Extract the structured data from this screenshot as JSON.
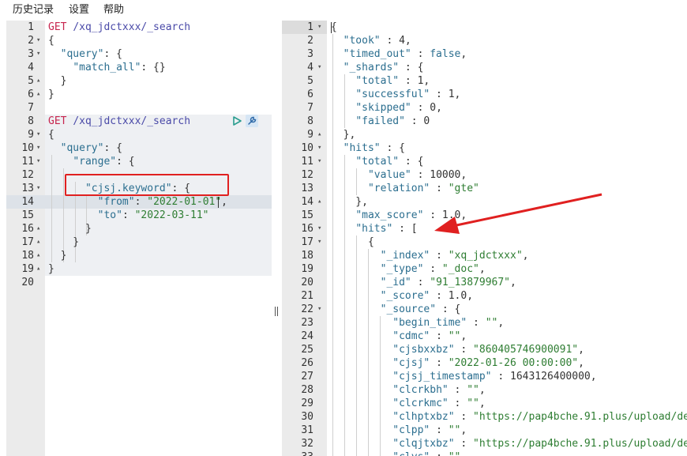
{
  "menu": [
    "历史记录",
    "设置",
    "帮助"
  ],
  "request_editor": {
    "lines": [
      {
        "n": "1",
        "fold": "",
        "tokens": [
          [
            "m",
            "GET"
          ],
          [
            "n",
            " "
          ],
          [
            "u",
            "/xq_jdctxxx/_search"
          ]
        ]
      },
      {
        "n": "2",
        "fold": "▾",
        "tokens": [
          [
            "n",
            "{"
          ]
        ]
      },
      {
        "n": "3",
        "fold": "▾",
        "tokens": [
          [
            "n",
            "  "
          ],
          [
            "k",
            "\"query\""
          ],
          [
            "n",
            ": {"
          ]
        ]
      },
      {
        "n": "4",
        "fold": "",
        "tokens": [
          [
            "n",
            "    "
          ],
          [
            "k",
            "\"match_all\""
          ],
          [
            "n",
            ": {}"
          ]
        ]
      },
      {
        "n": "5",
        "fold": "▴",
        "tokens": [
          [
            "n",
            "  }"
          ]
        ]
      },
      {
        "n": "6",
        "fold": "▴",
        "tokens": [
          [
            "n",
            "}"
          ]
        ]
      },
      {
        "n": "7",
        "fold": "",
        "tokens": []
      },
      {
        "n": "8",
        "fold": "",
        "tokens": [
          [
            "m",
            "GET"
          ],
          [
            "n",
            " "
          ],
          [
            "u",
            "/xq_jdctxxx/_search"
          ]
        ]
      },
      {
        "n": "9",
        "fold": "▾",
        "tokens": [
          [
            "n",
            "{"
          ]
        ]
      },
      {
        "n": "10",
        "fold": "▾",
        "tokens": [
          [
            "n",
            "  "
          ],
          [
            "k",
            "\"query\""
          ],
          [
            "n",
            ": {"
          ]
        ]
      },
      {
        "n": "11",
        "fold": "▾",
        "tokens": [
          [
            "n",
            "    "
          ],
          [
            "k",
            "\"range\""
          ],
          [
            "n",
            ": {"
          ]
        ]
      },
      {
        "n": "12",
        "fold": "",
        "tokens": []
      },
      {
        "n": "13",
        "fold": "▾",
        "tokens": [
          [
            "n",
            "      "
          ],
          [
            "k",
            "\"cjsj.keyword\""
          ],
          [
            "n",
            ": {"
          ]
        ]
      },
      {
        "n": "14",
        "fold": "",
        "tokens": [
          [
            "n",
            "        "
          ],
          [
            "k",
            "\"from\""
          ],
          [
            "n",
            ": "
          ],
          [
            "s",
            "\"2022-01-01\""
          ],
          [
            "n",
            ","
          ]
        ]
      },
      {
        "n": "15",
        "fold": "",
        "tokens": [
          [
            "n",
            "        "
          ],
          [
            "k",
            "\"to\""
          ],
          [
            "n",
            ": "
          ],
          [
            "s",
            "\"2022-03-11\""
          ]
        ]
      },
      {
        "n": "16",
        "fold": "▴",
        "tokens": [
          [
            "n",
            "      }"
          ]
        ]
      },
      {
        "n": "17",
        "fold": "▴",
        "tokens": [
          [
            "n",
            "    }"
          ]
        ]
      },
      {
        "n": "18",
        "fold": "▴",
        "tokens": [
          [
            "n",
            "  }"
          ]
        ]
      },
      {
        "n": "19",
        "fold": "▴",
        "tokens": [
          [
            "n",
            "}"
          ]
        ]
      },
      {
        "n": "20",
        "fold": "",
        "tokens": []
      }
    ]
  },
  "response_viewer": {
    "lines": [
      {
        "n": "1",
        "fold": "▾",
        "tokens": [
          [
            "n",
            "{"
          ]
        ]
      },
      {
        "n": "2",
        "fold": "",
        "tokens": [
          [
            "n",
            "  "
          ],
          [
            "k",
            "\"took\""
          ],
          [
            "n",
            " : 4,"
          ]
        ]
      },
      {
        "n": "3",
        "fold": "",
        "tokens": [
          [
            "n",
            "  "
          ],
          [
            "k",
            "\"timed_out\""
          ],
          [
            "n",
            " : "
          ],
          [
            "c",
            "false"
          ],
          [
            "n",
            ","
          ]
        ]
      },
      {
        "n": "4",
        "fold": "▾",
        "tokens": [
          [
            "n",
            "  "
          ],
          [
            "k",
            "\"_shards\""
          ],
          [
            "n",
            " : {"
          ]
        ]
      },
      {
        "n": "5",
        "fold": "",
        "tokens": [
          [
            "n",
            "    "
          ],
          [
            "k",
            "\"total\""
          ],
          [
            "n",
            " : 1,"
          ]
        ]
      },
      {
        "n": "6",
        "fold": "",
        "tokens": [
          [
            "n",
            "    "
          ],
          [
            "k",
            "\"successful\""
          ],
          [
            "n",
            " : 1,"
          ]
        ]
      },
      {
        "n": "7",
        "fold": "",
        "tokens": [
          [
            "n",
            "    "
          ],
          [
            "k",
            "\"skipped\""
          ],
          [
            "n",
            " : 0,"
          ]
        ]
      },
      {
        "n": "8",
        "fold": "",
        "tokens": [
          [
            "n",
            "    "
          ],
          [
            "k",
            "\"failed\""
          ],
          [
            "n",
            " : 0"
          ]
        ]
      },
      {
        "n": "9",
        "fold": "▴",
        "tokens": [
          [
            "n",
            "  },"
          ]
        ]
      },
      {
        "n": "10",
        "fold": "▾",
        "tokens": [
          [
            "n",
            "  "
          ],
          [
            "k",
            "\"hits\""
          ],
          [
            "n",
            " : {"
          ]
        ]
      },
      {
        "n": "11",
        "fold": "▾",
        "tokens": [
          [
            "n",
            "    "
          ],
          [
            "k",
            "\"total\""
          ],
          [
            "n",
            " : {"
          ]
        ]
      },
      {
        "n": "12",
        "fold": "",
        "tokens": [
          [
            "n",
            "      "
          ],
          [
            "k",
            "\"value\""
          ],
          [
            "n",
            " : 10000,"
          ]
        ]
      },
      {
        "n": "13",
        "fold": "",
        "tokens": [
          [
            "n",
            "      "
          ],
          [
            "k",
            "\"relation\""
          ],
          [
            "n",
            " : "
          ],
          [
            "s",
            "\"gte\""
          ]
        ]
      },
      {
        "n": "14",
        "fold": "▴",
        "tokens": [
          [
            "n",
            "    },"
          ]
        ]
      },
      {
        "n": "15",
        "fold": "",
        "tokens": [
          [
            "n",
            "    "
          ],
          [
            "k",
            "\"max_score\""
          ],
          [
            "n",
            " : 1.0,"
          ]
        ]
      },
      {
        "n": "16",
        "fold": "▾",
        "tokens": [
          [
            "n",
            "    "
          ],
          [
            "k",
            "\"hits\""
          ],
          [
            "n",
            " : ["
          ]
        ]
      },
      {
        "n": "17",
        "fold": "▾",
        "tokens": [
          [
            "n",
            "      {"
          ]
        ]
      },
      {
        "n": "18",
        "fold": "",
        "tokens": [
          [
            "n",
            "        "
          ],
          [
            "k",
            "\"_index\""
          ],
          [
            "n",
            " : "
          ],
          [
            "s",
            "\"xq_jdctxxx\""
          ],
          [
            "n",
            ","
          ]
        ]
      },
      {
        "n": "19",
        "fold": "",
        "tokens": [
          [
            "n",
            "        "
          ],
          [
            "k",
            "\"_type\""
          ],
          [
            "n",
            " : "
          ],
          [
            "s",
            "\"_doc\""
          ],
          [
            "n",
            ","
          ]
        ]
      },
      {
        "n": "20",
        "fold": "",
        "tokens": [
          [
            "n",
            "        "
          ],
          [
            "k",
            "\"_id\""
          ],
          [
            "n",
            " : "
          ],
          [
            "s",
            "\"91_13879967\""
          ],
          [
            "n",
            ","
          ]
        ]
      },
      {
        "n": "21",
        "fold": "",
        "tokens": [
          [
            "n",
            "        "
          ],
          [
            "k",
            "\"_score\""
          ],
          [
            "n",
            " : 1.0,"
          ]
        ]
      },
      {
        "n": "22",
        "fold": "▾",
        "tokens": [
          [
            "n",
            "        "
          ],
          [
            "k",
            "\"_source\""
          ],
          [
            "n",
            " : {"
          ]
        ]
      },
      {
        "n": "23",
        "fold": "",
        "tokens": [
          [
            "n",
            "          "
          ],
          [
            "k",
            "\"begin_time\""
          ],
          [
            "n",
            " : "
          ],
          [
            "s",
            "\"\""
          ],
          [
            "n",
            ","
          ]
        ]
      },
      {
        "n": "24",
        "fold": "",
        "tokens": [
          [
            "n",
            "          "
          ],
          [
            "k",
            "\"cdmc\""
          ],
          [
            "n",
            " : "
          ],
          [
            "s",
            "\"\""
          ],
          [
            "n",
            ","
          ]
        ]
      },
      {
        "n": "25",
        "fold": "",
        "tokens": [
          [
            "n",
            "          "
          ],
          [
            "k",
            "\"cjsbxxbz\""
          ],
          [
            "n",
            " : "
          ],
          [
            "s",
            "\"860405746900091\""
          ],
          [
            "n",
            ","
          ]
        ]
      },
      {
        "n": "26",
        "fold": "",
        "tokens": [
          [
            "n",
            "          "
          ],
          [
            "k",
            "\"cjsj\""
          ],
          [
            "n",
            " : "
          ],
          [
            "s",
            "\"2022-01-26 00:00:00\""
          ],
          [
            "n",
            ","
          ]
        ]
      },
      {
        "n": "27",
        "fold": "",
        "tokens": [
          [
            "n",
            "          "
          ],
          [
            "k",
            "\"cjsj_timestamp\""
          ],
          [
            "n",
            " : 1643126400000,"
          ]
        ]
      },
      {
        "n": "28",
        "fold": "",
        "tokens": [
          [
            "n",
            "          "
          ],
          [
            "k",
            "\"clcrkbh\""
          ],
          [
            "n",
            " : "
          ],
          [
            "s",
            "\"\""
          ],
          [
            "n",
            ","
          ]
        ]
      },
      {
        "n": "29",
        "fold": "",
        "tokens": [
          [
            "n",
            "          "
          ],
          [
            "k",
            "\"clcrkmc\""
          ],
          [
            "n",
            " : "
          ],
          [
            "s",
            "\"\""
          ],
          [
            "n",
            ","
          ]
        ]
      },
      {
        "n": "30",
        "fold": "",
        "tokens": [
          [
            "n",
            "          "
          ],
          [
            "k",
            "\"clhptxbz\""
          ],
          [
            "n",
            " : "
          ],
          [
            "s",
            "\"https://pap4bche.91.plus/upload/dev"
          ]
        ]
      },
      {
        "n": "31",
        "fold": "",
        "tokens": [
          [
            "n",
            "          "
          ],
          [
            "k",
            "\"clpp\""
          ],
          [
            "n",
            " : "
          ],
          [
            "s",
            "\"\""
          ],
          [
            "n",
            ","
          ]
        ]
      },
      {
        "n": "32",
        "fold": "",
        "tokens": [
          [
            "n",
            "          "
          ],
          [
            "k",
            "\"clqjtxbz\""
          ],
          [
            "n",
            " : "
          ],
          [
            "s",
            "\"https://pap4bche.91.plus/upload/dev"
          ]
        ]
      },
      {
        "n": "33",
        "fold": "",
        "tokens": [
          [
            "n",
            "          "
          ],
          [
            "k",
            "\"clys\""
          ],
          [
            "n",
            " : "
          ],
          [
            "s",
            "\"\""
          ]
        ]
      }
    ]
  },
  "colors": {
    "annotation_red": "#e02020",
    "gutter": "#ebebeb",
    "method": "#c7254e",
    "string": "#2e7d32",
    "key": "#2b6e8f"
  },
  "icons": {
    "run": "play-icon",
    "settings": "wrench-icon"
  }
}
